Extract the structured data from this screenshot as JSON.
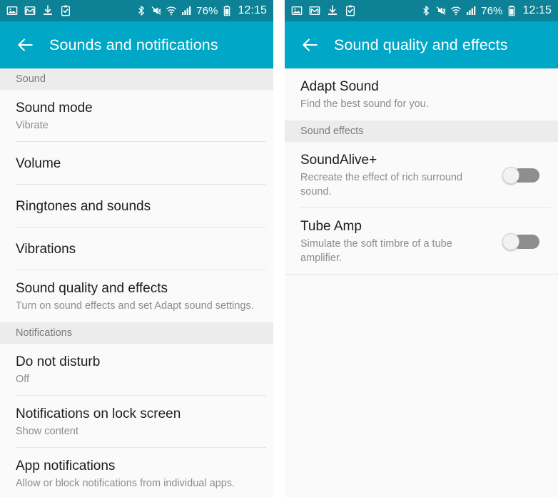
{
  "colors": {
    "status_bar": "#0d8296",
    "app_bar": "#00a7c6",
    "section_header_bg": "#ececec",
    "list_bg": "#fafafa",
    "title_text": "#1c1c1c",
    "subtitle_text": "#8c8c8c",
    "toggle_track_off": "#8e8e8e",
    "toggle_knob": "#f2f2f2"
  },
  "status_bar": {
    "left_icons": [
      "image-icon",
      "gmail-icon",
      "download-icon",
      "clipboard-check-icon"
    ],
    "right_icons": [
      "bluetooth-icon",
      "vibrate-mute-icon",
      "wifi-icon",
      "signal-bars-icon"
    ],
    "battery_percent": "76%",
    "battery_icon": "battery-icon",
    "clock": "12:15"
  },
  "left_screen": {
    "back_icon": "back-arrow-icon",
    "title": "Sounds and notifications",
    "sections": [
      {
        "header": "Sound",
        "rows": [
          {
            "title": "Sound mode",
            "subtitle": "Vibrate"
          },
          {
            "title": "Volume",
            "subtitle": ""
          },
          {
            "title": "Ringtones and sounds",
            "subtitle": ""
          },
          {
            "title": "Vibrations",
            "subtitle": ""
          },
          {
            "title": "Sound quality and effects",
            "subtitle": "Turn on sound effects and set Adapt sound settings."
          }
        ]
      },
      {
        "header": "Notifications",
        "rows": [
          {
            "title": "Do not disturb",
            "subtitle": "Off"
          },
          {
            "title": "Notifications on lock screen",
            "subtitle": "Show content"
          },
          {
            "title": "App notifications",
            "subtitle": "Allow or block notifications from individual apps."
          }
        ]
      }
    ]
  },
  "right_screen": {
    "back_icon": "back-arrow-icon",
    "title": "Sound quality and effects",
    "top_rows": [
      {
        "title": "Adapt Sound",
        "subtitle": "Find the best sound for you."
      }
    ],
    "sections": [
      {
        "header": "Sound effects",
        "rows": [
          {
            "title": "SoundAlive+",
            "subtitle": "Recreate the effect of rich surround sound.",
            "toggle": "off"
          },
          {
            "title": "Tube Amp",
            "subtitle": "Simulate the soft timbre of a tube amplifier.",
            "toggle": "off"
          }
        ]
      }
    ]
  }
}
